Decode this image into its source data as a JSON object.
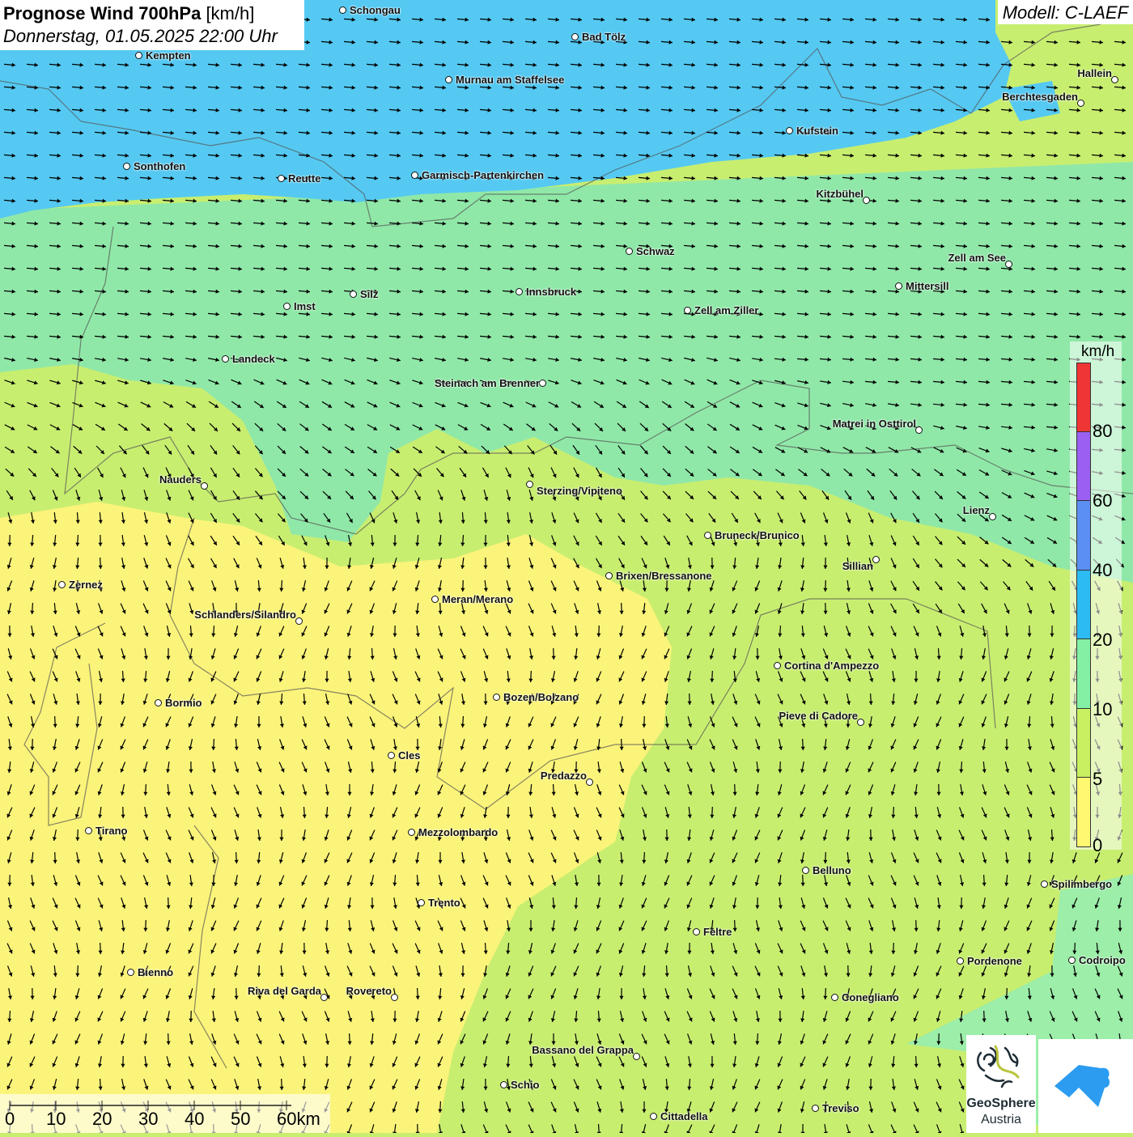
{
  "header": {
    "title_bold": "Prognose Wind 700hPa",
    "title_unit": "[km/h]",
    "datetime": "Donnerstag, 01.05.2025 22:00 Uhr"
  },
  "model": "Modell: C-LAEF",
  "legend": {
    "unit": "km/h",
    "labels": [
      "80",
      "60",
      "40",
      "20",
      "10",
      "5",
      "0"
    ],
    "colors": [
      "#f03535",
      "#9b5ff2",
      "#5b8ff2",
      "#2cbbf2",
      "#84f0a4",
      "#c8f060",
      "#fff870"
    ]
  },
  "scale_bar": {
    "labels": [
      "0",
      "10",
      "20",
      "30",
      "40",
      "50",
      "60km"
    ]
  },
  "cities": [
    "Schongau",
    "Bad Tölz",
    "Kempten",
    "Murnau am Staffelsee",
    "Hallein",
    "Berchtesgaden",
    "Kufstein",
    "Sonthofen",
    "Reutte",
    "Garmisch-Partenkirchen",
    "Kitzbühel",
    "Schwaz",
    "Zell am See",
    "Mittersill",
    "Innsbruck",
    "Silz",
    "Imst",
    "Zell am Ziller",
    "Landeck",
    "Steinach am Brenner",
    "Matrei in Osttirol",
    "Nauders",
    "Sterzing/Vipiteno",
    "Lienz",
    "Bruneck/Brunico",
    "Sillian",
    "Brixen/Bressanone",
    "Zernez",
    "Meran/Merano",
    "Schlanders/Silandro",
    "Cortina d'Ampezzo",
    "Bozen/Bolzano",
    "Bormio",
    "Pieve di Cadore",
    "Cles",
    "Predazzo",
    "Tirano",
    "Mezzolombardo",
    "Belluno",
    "Spilimbergo",
    "Trento",
    "Feltre",
    "Pordenone",
    "Codroipo",
    "Bienno",
    "Riva del Garda",
    "Rovereto",
    "Conegliano",
    "Bassano del Grappa",
    "Schio",
    "Treviso",
    "Cittadella"
  ],
  "logos": {
    "geosphere_line1": "GeoSphere",
    "geosphere_line2": "Austria"
  },
  "colors": {
    "blue_zone": "#55c9f2",
    "green_zone": "#90e8a8",
    "lime_zone": "#c8ee70",
    "yellow_zone": "#fbf47a"
  }
}
